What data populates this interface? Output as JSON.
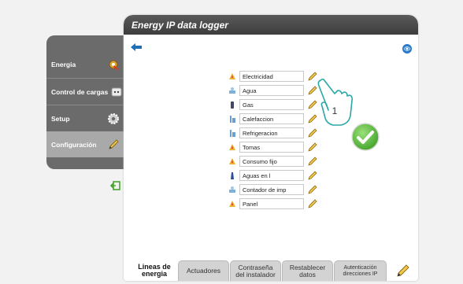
{
  "window": {
    "title": "Energy IP data logger"
  },
  "sidebar": {
    "items": [
      {
        "label": "Energia",
        "icon": "gear-flame-icon"
      },
      {
        "label": "Control de cargas",
        "icon": "plug-icon"
      },
      {
        "label": "Setup",
        "icon": "gear-icon"
      },
      {
        "label": "Configuración",
        "icon": "pencil-icon"
      }
    ],
    "active": "Configuración"
  },
  "lines": [
    {
      "label": "Electricidad",
      "icon": "electricity-icon"
    },
    {
      "label": "Agua",
      "icon": "water-icon"
    },
    {
      "label": "Gas",
      "icon": "gas-icon"
    },
    {
      "label": "Calefaccion",
      "icon": "radiator-icon"
    },
    {
      "label": "Refrigeracion",
      "icon": "radiator-icon"
    },
    {
      "label": "Tomas",
      "icon": "electricity-icon"
    },
    {
      "label": "Consumo fijo",
      "icon": "electricity-icon"
    },
    {
      "label": "Aguas en l",
      "icon": "bottle-icon"
    },
    {
      "label": "Contador de imp",
      "icon": "water-icon"
    },
    {
      "label": "Panel",
      "icon": "electricity-icon"
    }
  ],
  "callout": {
    "number": "1"
  },
  "tabs": [
    {
      "label": "Lineas de energia",
      "line1": "Lineas de",
      "line2": "energia"
    },
    {
      "label": "Actuadores"
    },
    {
      "label": "Contraseña del instalador",
      "line1": "Contraseña",
      "line2": "del instalador"
    },
    {
      "label": "Restablecer datos",
      "line1": "Restablecer",
      "line2": "datos"
    },
    {
      "label": "Autenticación direcciones IP",
      "line1": "Autenticación",
      "line2": "direcciones IP"
    }
  ],
  "colors": {
    "titlebar": "#454545",
    "sidebar": "#6b6b6b",
    "accent_blue": "#1f6fb8",
    "check_green": "#5bbf3c"
  }
}
